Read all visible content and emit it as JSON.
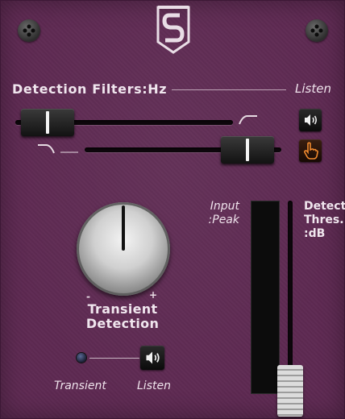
{
  "filters": {
    "title": "Detection Filters:Hz",
    "listen_label": "Listen",
    "high_pass_level": 0.05,
    "low_pass_level": 0.95,
    "listen_button_icon": "speaker-icon",
    "solo_button_icon": "hand-pointer-icon"
  },
  "transient": {
    "knob_label_line1": "Transient",
    "knob_label_line2": "Detection",
    "minus_label": "-",
    "plus_label": "+",
    "knob_value": 0.5,
    "indicator_label": "Transient",
    "listen_label": "Listen",
    "listen_button_icon": "speaker-icon"
  },
  "meter": {
    "input_label_line1": "Input",
    "input_label_line2": ":Peak",
    "threshold_label_line1": "Detect",
    "threshold_label_line2": "Thres.",
    "threshold_label_line3": ":dB",
    "threshold_level": 0.02
  },
  "colors": {
    "panel": "#5e2a52",
    "text": "#f0e6ee",
    "solo_active": "#f08a2e"
  }
}
